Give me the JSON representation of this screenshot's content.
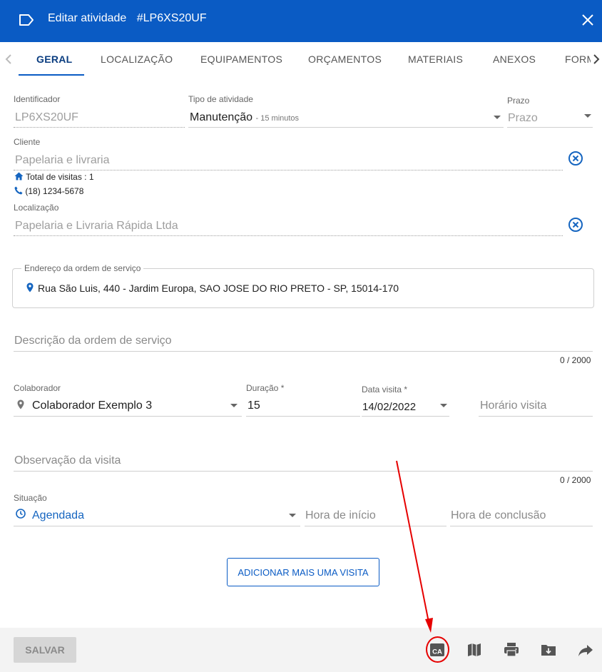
{
  "header": {
    "title": "Editar atividade",
    "code": "#LP6XS20UF"
  },
  "tabs": [
    {
      "label": "GERAL",
      "active": true
    },
    {
      "label": "LOCALIZAÇÃO"
    },
    {
      "label": "EQUIPAMENTOS"
    },
    {
      "label": "ORÇAMENTOS"
    },
    {
      "label": "MATERIAIS"
    },
    {
      "label": "ANEXOS"
    },
    {
      "label": "FORM"
    }
  ],
  "form": {
    "identificador": {
      "label": "Identificador",
      "value": "LP6XS20UF"
    },
    "tipo_atividade": {
      "label": "Tipo de atividade",
      "value": "Manutenção",
      "sub": "- 15 minutos"
    },
    "prazo": {
      "label": "Prazo",
      "placeholder": "Prazo"
    },
    "cliente": {
      "label": "Cliente",
      "value": "Papelaria e livraria",
      "visits": "Total de visitas : 1",
      "phone": "(18) 1234-5678"
    },
    "localizacao": {
      "label": "Localização",
      "value": "Papelaria e Livraria Rápida Ltda"
    },
    "endereco": {
      "label": "Endereço da ordem de serviço",
      "value": "Rua São Luis, 440 - Jardim Europa, SAO JOSE DO RIO PRETO - SP, 15014-170"
    },
    "descricao": {
      "placeholder": "Descrição da ordem de serviço",
      "counter": "0 / 2000"
    },
    "colaborador": {
      "label": "Colaborador",
      "value": "Colaborador Exemplo 3"
    },
    "duracao": {
      "label": "Duração *",
      "value": "15"
    },
    "data_visita": {
      "label": "Data visita *",
      "value": "14/02/2022"
    },
    "horario_visita": {
      "placeholder": "Horário visita"
    },
    "observacao": {
      "placeholder": "Observação da visita",
      "counter": "0 / 2000"
    },
    "situacao": {
      "label": "Situação",
      "value": "Agendada"
    },
    "hora_inicio": {
      "placeholder": "Hora de início"
    },
    "hora_conclusao": {
      "placeholder": "Hora de conclusão"
    },
    "add_visit_label": "ADICIONAR MAIS UMA VISITA"
  },
  "footer": {
    "save_label": "SALVAR",
    "actions": [
      "ca-icon",
      "map-icon",
      "print-icon",
      "folder-download-icon",
      "share-icon"
    ],
    "ca_label": "CA"
  },
  "colors": {
    "primary": "#0a5bc4",
    "annotation": "#e60000"
  }
}
